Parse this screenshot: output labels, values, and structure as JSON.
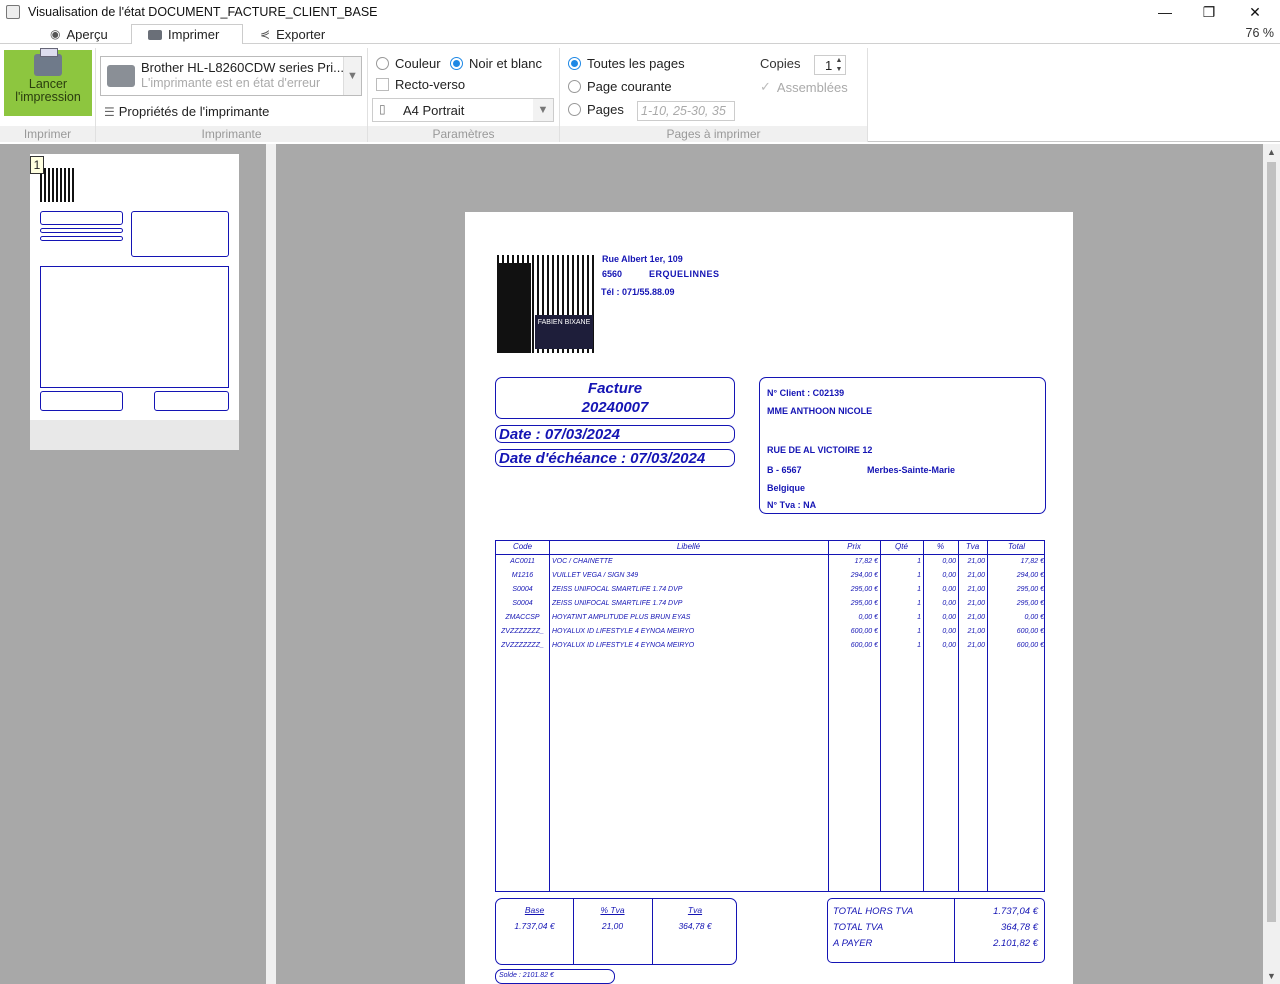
{
  "window": {
    "title": "Visualisation de l'état DOCUMENT_FACTURE_CLIENT_BASE",
    "minimize": "—",
    "restore": "❐",
    "close": "✕"
  },
  "tabs": [
    {
      "label": "Aperçu",
      "icon": "eye-icon"
    },
    {
      "label": "Imprimer",
      "icon": "printer-icon"
    },
    {
      "label": "Exporter",
      "icon": "share-icon"
    }
  ],
  "zoom": "76 %",
  "ribbon": {
    "launch_label_1": "Lancer",
    "launch_label_2": "l'impression",
    "group_imprimer": "Imprimer",
    "printer_name": "Brother HL-L8260CDW series Pri...",
    "printer_status": "L'imprimante est en état d'erreur",
    "printer_props": "Propriétés de l'imprimante",
    "group_printer": "Imprimante",
    "color": "Couleur",
    "bw": "Noir et blanc",
    "duplex": "Recto-verso",
    "paper": "A4 Portrait",
    "group_params": "Paramètres",
    "all_pages": "Toutes les pages",
    "current_page": "Page courante",
    "pages": "Pages",
    "pages_placeholder": "1-10, 25-30, 35",
    "copies_label": "Copies",
    "copies_value": "1",
    "collated": "Assemblées",
    "group_pages": "Pages à imprimer"
  },
  "thumb": {
    "page_number": "1"
  },
  "invoice": {
    "logo_text": "FABIEN BIXANE",
    "address1": "Rue Albert 1er, 109",
    "postal": "6560",
    "city": "ERQUELINNES",
    "tel": "Tél : 071/55.88.09",
    "doc_type": "Facture",
    "doc_number": "20240007",
    "date": "Date : 07/03/2024",
    "due_date": "Date d'échéance : 07/03/2024",
    "client_no": "N° Client : C02139",
    "client_name": "MME ANTHOON NICOLE",
    "client_street": "RUE DE AL VICTOIRE 12",
    "client_postal": "B - 6567",
    "client_city": "Merbes-Sainte-Marie",
    "client_country": "Belgique",
    "client_vat": "N° Tva : NA",
    "headers": [
      "Code",
      "Libellé",
      "Prix",
      "Qté",
      "%",
      "Tva",
      "Total"
    ],
    "rows": [
      {
        "code": "AC0011",
        "label": "VOC / CHAINETTE",
        "price": "17,82 €",
        "qty": "1",
        "pct": "0,00",
        "tva": "21,00",
        "total": "17,82 €"
      },
      {
        "code": "M1216",
        "label": "VUILLET VEGA / SIGN 349",
        "price": "294,00 €",
        "qty": "1",
        "pct": "0,00",
        "tva": "21,00",
        "total": "294,00 €"
      },
      {
        "code": "S0004",
        "label": "ZEISS UNIFOCAL SMARTLIFE 1.74 DVP",
        "price": "295,00 €",
        "qty": "1",
        "pct": "0,00",
        "tva": "21,00",
        "total": "295,00 €"
      },
      {
        "code": "S0004",
        "label": "ZEISS UNIFOCAL SMARTLIFE 1.74 DVP",
        "price": "295,00 €",
        "qty": "1",
        "pct": "0,00",
        "tva": "21,00",
        "total": "295,00 €"
      },
      {
        "code": "ZMACCSP",
        "label": "HOYATINT AMPLITUDE PLUS BRUN EYAS",
        "price": "0,00 €",
        "qty": "1",
        "pct": "0,00",
        "tva": "21,00",
        "total": "0,00 €"
      },
      {
        "code": "ZVZZZZZZZ_",
        "label": "HOYALUX ID LIFESTYLE 4 EYNOA MEIRYO",
        "price": "600,00 €",
        "qty": "1",
        "pct": "0,00",
        "tva": "21,00",
        "total": "600,00 €"
      },
      {
        "code": "ZVZZZZZZZ_",
        "label": "HOYALUX ID LIFESTYLE 4 EYNOA MEIRYO",
        "price": "600,00 €",
        "qty": "1",
        "pct": "0,00",
        "tva": "21,00",
        "total": "600,00 €"
      }
    ],
    "vat_headers": [
      "Base",
      "% Tva",
      "Tva"
    ],
    "vat_values": [
      "1.737,04 €",
      "21,00",
      "364,78 €"
    ],
    "totals": [
      {
        "label": "TOTAL HORS TVA",
        "value": "1.737,04 €"
      },
      {
        "label": "TOTAL TVA",
        "value": "364,78 €"
      },
      {
        "label": "A PAYER",
        "value": "2.101,82 €"
      }
    ],
    "solde": "Solde : 2101.82 €"
  }
}
